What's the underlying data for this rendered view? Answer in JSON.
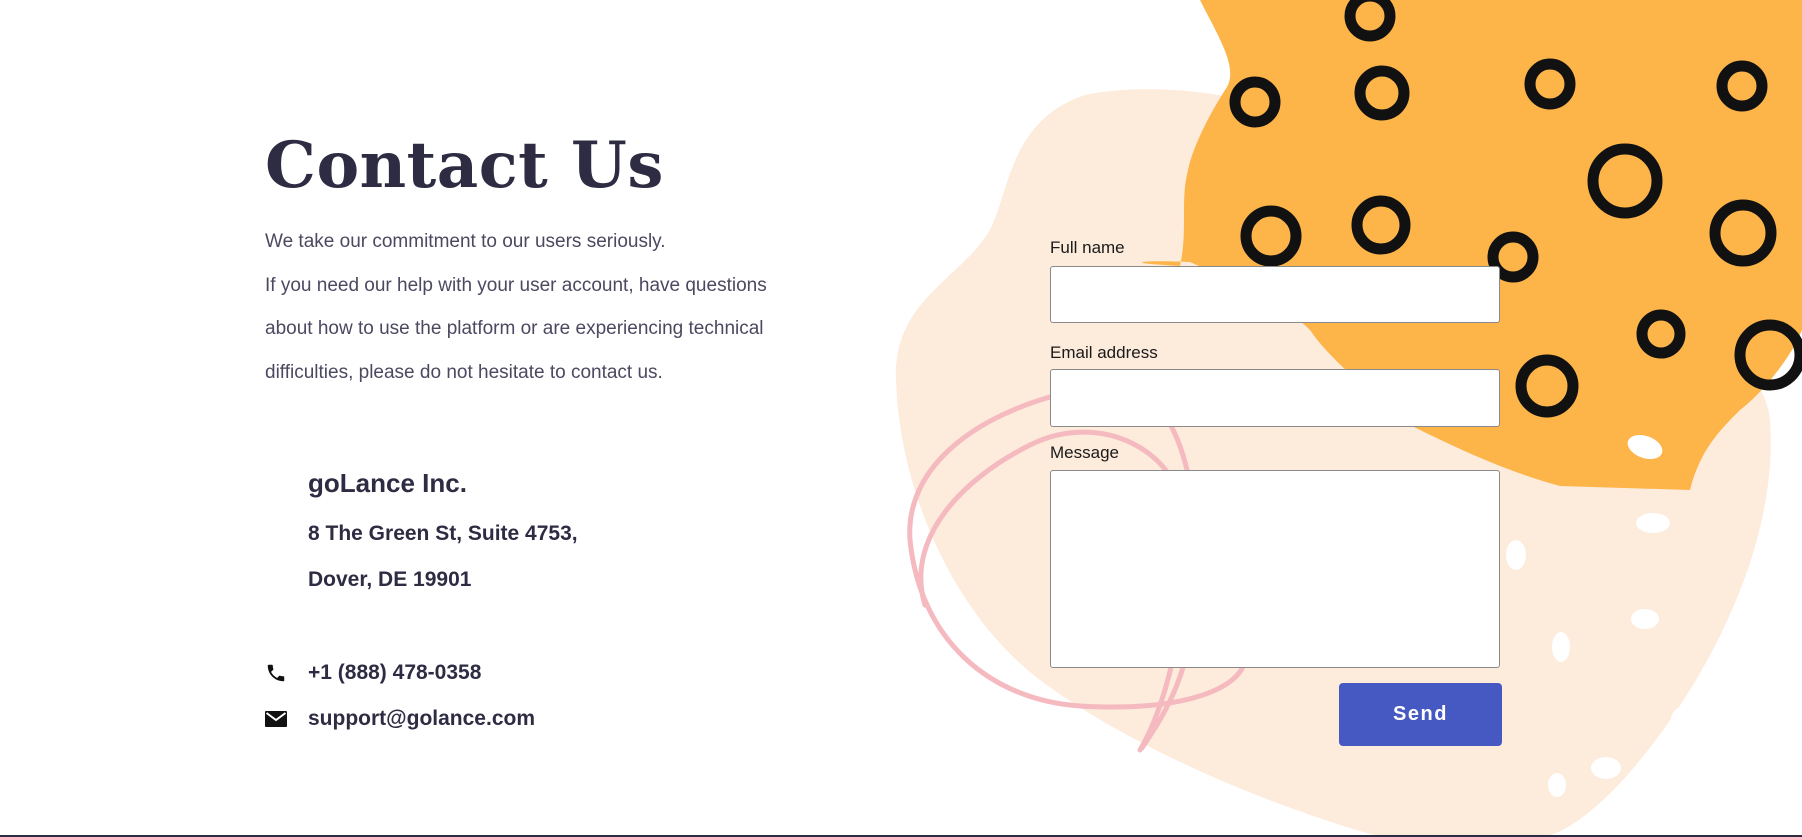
{
  "colors": {
    "heading": "#2e2c42",
    "body_text": "#4b4960",
    "accent_button": "#4659c2",
    "blob_peach": "#fdebdc",
    "blob_orange": "#fdb54a",
    "scribble_pink": "#f5b9c0"
  },
  "contact": {
    "title": "Contact Us",
    "intro_lines": [
      "We take our commitment to our users seriously.",
      "If you need our help with your user account, have questions",
      "about how to use the platform or are experiencing technical",
      "difficulties, please do not hesitate to contact us."
    ],
    "company": "goLance Inc.",
    "address_line1": "8 The Green St, Suite 4753,",
    "address_line2": "Dover, DE 19901",
    "phone": "+1 (888) 478-0358",
    "phone_icon": "phone-icon",
    "email": "support@golance.com",
    "email_icon": "envelope-icon"
  },
  "form": {
    "full_name_label": "Full name",
    "full_name_value": "",
    "email_label": "Email address",
    "email_value": "",
    "message_label": "Message",
    "message_value": "",
    "send_label": "Send"
  }
}
